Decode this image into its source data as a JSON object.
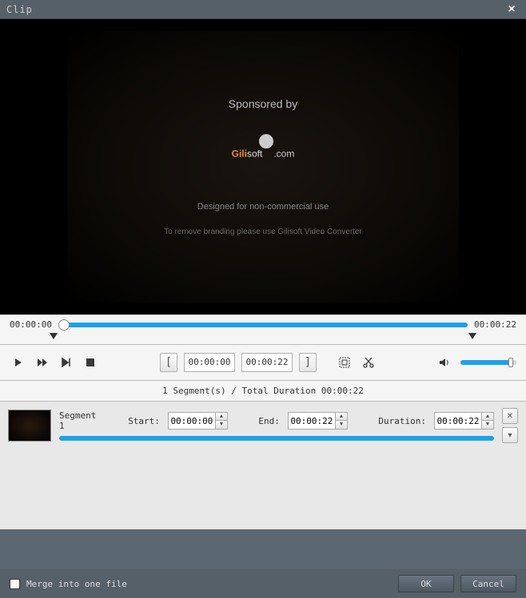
{
  "window": {
    "title": "Clip"
  },
  "video": {
    "sponsored": "Sponsored by",
    "logo_gili": "Gili",
    "logo_soft": "soft",
    "logo_com": ".com",
    "designed": "Designed for non-commercial use",
    "remove": "To remove branding please use Gilisoft Video Converter"
  },
  "timeline": {
    "start_time": "00:00:00",
    "end_time": "00:00:22"
  },
  "controls": {
    "in_time": "00:00:00",
    "out_time": "00:00:22"
  },
  "summary": "1 Segment(s) / Total Duration 00:00:22",
  "segment": {
    "name": "Segment 1",
    "start_label": "Start:",
    "start_value": "00:00:00",
    "end_label": "End:",
    "end_value": "00:00:22",
    "duration_label": "Duration:",
    "duration_value": "00:00:22"
  },
  "footer": {
    "merge_label": "Merge into one file",
    "ok": "OK",
    "cancel": "Cancel"
  }
}
